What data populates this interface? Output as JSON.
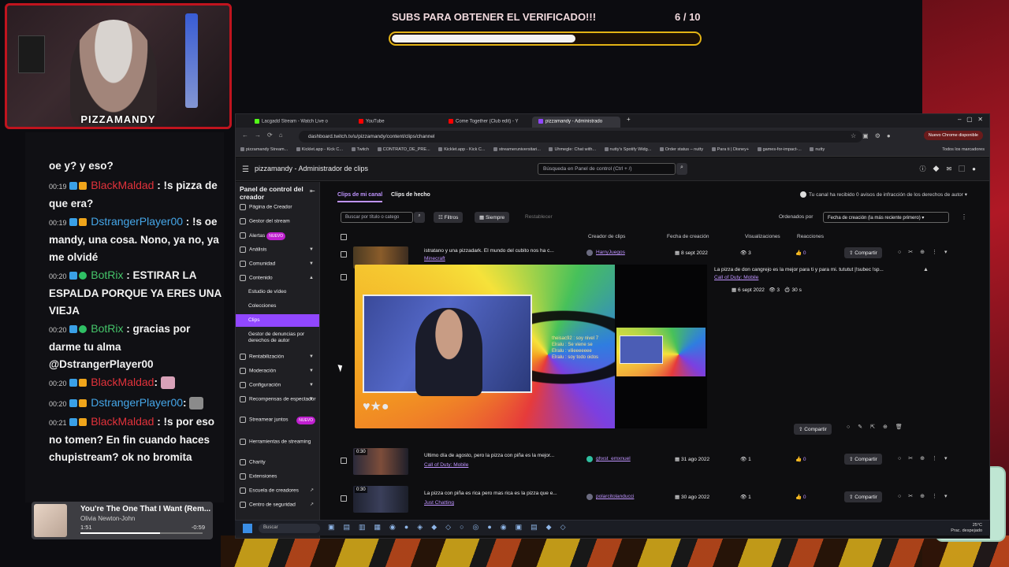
{
  "colors": {
    "accent": "#9147ff",
    "link": "#bf94ff",
    "goal_border": "#e3b315",
    "webcam_border": "#c0141e"
  },
  "stream_overlay": {
    "webcam_name": "PIZZAMANDY",
    "goal": {
      "title": "SUBS PARA OBTENER EL VERIFICADO!!!",
      "count": "6 / 10",
      "progress": 0.6
    },
    "chat": [
      {
        "time": "",
        "user": "",
        "text": "oe y? y eso?"
      },
      {
        "time": "00:19",
        "user": "BlackMaldad",
        "user_color": "red",
        "text": ": !s pizza de que era?"
      },
      {
        "time": "00:19",
        "user": "DstrangerPlayer00",
        "user_color": "blue",
        "text": ": !s oe mandy, una cosa. Nono, ya no, ya me olvidé"
      },
      {
        "time": "00:20",
        "user": "BotRix",
        "user_color": "green",
        "text": ": ESTIRAR LA ESPALDA PORQUE YA ERES UNA VIEJA"
      },
      {
        "time": "00:20",
        "user": "BotRix",
        "user_color": "green",
        "text": ": gracias por darme tu alma @DstrangerPlayer00"
      },
      {
        "time": "00:20",
        "user": "BlackMaldad",
        "user_color": "red",
        "text": ":"
      },
      {
        "time": "00:20",
        "user": "DstrangerPlayer00",
        "user_color": "blue",
        "text": ":"
      },
      {
        "time": "00:21",
        "user": "BlackMaldad",
        "user_color": "red",
        "text": ": !s por eso no tomen? En fin cuando haces chupistream? ok no bromita"
      }
    ],
    "music": {
      "title": "You're The One That I Want (Rem...",
      "artist": "Olivia Newton-John",
      "elapsed": "1:51",
      "remaining": "-0:59",
      "progress": 0.65
    }
  },
  "browser": {
    "tabs": [
      {
        "label": "Lacgadd Stream - Watch Live o",
        "color": "#53fc18"
      },
      {
        "label": "YouTube",
        "color": "#ff0000"
      },
      {
        "label": "Come Together (Club edit) - Y",
        "color": "#ff0000"
      },
      {
        "label": "pizzamandy - Administrado",
        "color": "#9147ff",
        "active": true
      }
    ],
    "new_tab": "+",
    "url": "dashboard.twitch.tv/u/pizzamandy/content/clips/channel",
    "chrome_update": "Nuevo Chrome disponible",
    "bookmarks": [
      "pizzamandy Stream...",
      "Kicklet.app - Kick C...",
      "Twitch",
      "CONTRATO_DE_PRE...",
      "Kicklet.app - Kick C...",
      "streameruniversitari...",
      "Uhmegle: Chat with...",
      "nutty's Spotify Widg...",
      "Order status – nutty",
      "Para ti | Disney+",
      "games-for-impact-...",
      "nutty"
    ],
    "bookmarks_right": "Todos los marcadores"
  },
  "twitch": {
    "page_title": "pizzamandy - Administrador de clips",
    "search_placeholder": "Búsqueda en Panel de control (Ctrl + /)",
    "sidebar": {
      "title": "Panel de control del creador",
      "items": [
        {
          "label": "Página de Creador"
        },
        {
          "label": "Gestor del stream"
        },
        {
          "label": "Alertas",
          "badge": "NUEVO"
        },
        {
          "label": "Análisis"
        },
        {
          "label": "Comunidad"
        },
        {
          "label": "Contenido"
        }
      ],
      "content_sub": [
        "Estudio de vídeo",
        "Colecciones",
        "Clips",
        "Gestor de denuncias por derechos de autor"
      ],
      "items_after": [
        {
          "label": "Rentabilización"
        },
        {
          "label": "Moderación"
        },
        {
          "label": "Configuración"
        },
        {
          "label": "Recompensas de espectador"
        },
        {
          "label": "Streamear juntos",
          "badge": "NUEVO"
        },
        {
          "label": "Herramientas de streaming"
        },
        {
          "label": "Charity"
        },
        {
          "label": "Extensiones"
        },
        {
          "label": "Escuela de creadores"
        },
        {
          "label": "Centro de seguridad"
        }
      ]
    },
    "content_tabs": [
      "Clips de mi canal",
      "Clips de hecho"
    ],
    "copyright_note": "Tu canal ha recibido 0 avisos de infracción de los derechos de autor",
    "filters": {
      "search_placeholder": "Buscar por título o catego",
      "filters_label": "Filtros",
      "range_label": "Siempre",
      "reset_label": "Restablecer",
      "sort_label": "Ordenados por",
      "sort_value": "Fecha de creación (la más reciente primero)"
    },
    "columns": [
      "Creador de clips",
      "Fecha de creación",
      "Visualizaciones",
      "Reacciones"
    ],
    "share_label": "Compartir",
    "clips": [
      {
        "title": "istratano y una pizzadark. El mundo del cubito nos ha c...",
        "category": "Minecraft",
        "creator": "HarryJuegos",
        "date": "8 sept 2022",
        "views": "3",
        "reactions": "0",
        "duration": ""
      },
      {
        "title": "Ultimo día de agosto, pero la pizza con piña es la mejor...",
        "category": "Call of Duty: Mobile",
        "creator": "ghxst_emxnuel",
        "date": "31 ago 2022",
        "views": "1",
        "reactions": "0",
        "duration": "0:30"
      },
      {
        "title": "La pizza con piña es rica pero mas rica es la pizza que e...",
        "category": "Just Chatting",
        "creator": "polarcitolanducci",
        "date": "30 ago 2022",
        "views": "1",
        "reactions": "0",
        "duration": "0:30"
      }
    ],
    "expanded": {
      "title": "La pizza de don cangrejo es la mejor para ti y para mi. tututut |!subec !sp...",
      "category": "Call of Duty: Mobile",
      "date": "6 sept 2022",
      "views": "3",
      "duration": "30 s",
      "chat_overlay": [
        "theisac92 : soy nivel 7",
        "Elralu : Se viene se",
        "Elralu : vilieeeeeee",
        "Elralu : soy todo oidos"
      ]
    }
  },
  "taskbar": {
    "search": "Buscar",
    "time_line1": "25°C",
    "time_line2": "Prac. despejado"
  }
}
